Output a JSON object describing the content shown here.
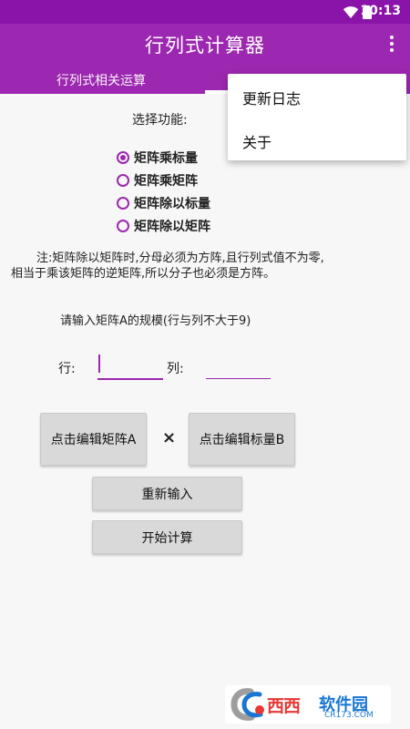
{
  "status_bar": {
    "time": "10:13",
    "icons": [
      "wifi-icon",
      "battery-icon"
    ]
  },
  "app_bar": {
    "title": "行列式计算器",
    "overflow_icon": "overflow-menu-icon"
  },
  "tabs": [
    {
      "label": "行列式相关运算"
    }
  ],
  "main": {
    "section_title": "选择功能:",
    "radio_options": [
      {
        "label": "矩阵乘标量",
        "checked": true
      },
      {
        "label": "矩阵乘矩阵",
        "checked": false
      },
      {
        "label": "矩阵除以标量",
        "checked": false
      },
      {
        "label": "矩阵除以矩阵",
        "checked": false
      }
    ],
    "note": "注:矩阵除以矩阵时,分母必须为方阵,且行列式值不为零,相当于乘该矩阵的逆矩阵,所以分子也必须是方阵。",
    "size_prompt": "请输入矩阵A的规模(行与列不大于9)",
    "rows_label": "行:",
    "rows_value": "",
    "cols_label": "列:",
    "cols_value": "",
    "buttons": {
      "edit_a": "点击编辑矩阵A",
      "operator": "×",
      "edit_b": "点击编辑标量B",
      "reset": "重新输入",
      "start": "开始计算"
    }
  },
  "dropdown": {
    "items": [
      "更新日志",
      "关于"
    ]
  },
  "watermark": {
    "main": "西西",
    "brand": "软件园",
    "sub": "CR173.COM"
  },
  "colors": {
    "accent": "#9c27b0",
    "status_bar": "#8a13a9",
    "button_bg": "#d9d9d9",
    "background": "#f7f7f7"
  }
}
